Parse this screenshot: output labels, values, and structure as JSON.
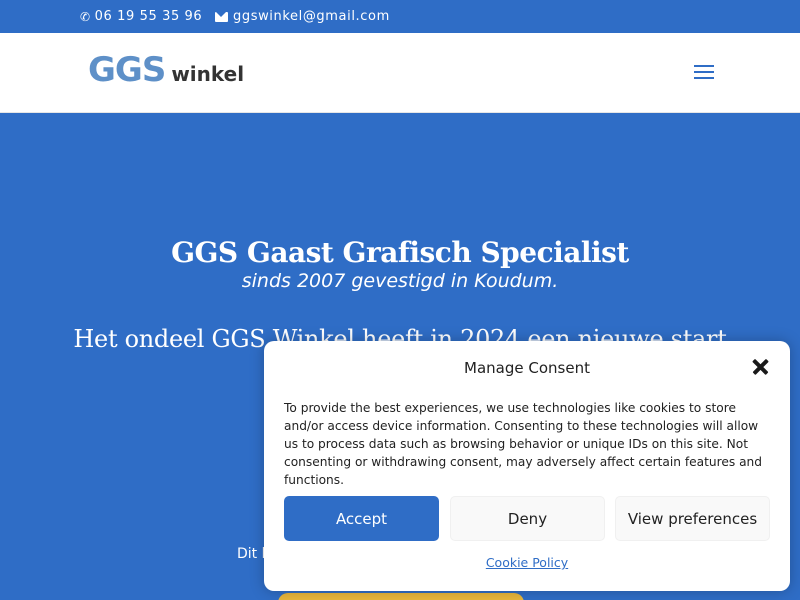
{
  "topbar": {
    "phone": "06 19 55 35 96",
    "email": "ggswinkel@gmail.com",
    "phone_icon": "phone-icon",
    "email_icon": "mail-icon"
  },
  "header": {
    "logo_ggs": "GGS",
    "logo_winkel": "winkel",
    "menu_icon": "hamburger-menu-icon"
  },
  "hero": {
    "title": "GGS Gaast Grafisch Specialist",
    "subtitle": "sinds 2007 gevestigd in Koudum.",
    "line": "Het ondeel GGS Winkel heeft in 2024 een nieuwe start",
    "small_text": "Dit b"
  },
  "consent": {
    "title": "Manage Consent",
    "body": "To provide the best experiences, we use technologies like cookies to store and/or access device information. Consenting to these technologies will allow us to process data such as browsing behavior or unique IDs on this site. Not consenting or withdrawing consent, may adversely affect certain features and functions.",
    "accept_label": "Accept",
    "deny_label": "Deny",
    "preferences_label": "View preferences",
    "policy_label": "Cookie Policy"
  },
  "colors": {
    "brand_blue": "#2f6dc6",
    "logo_blue": "#5e90c8",
    "button_gold": "#e8b73c"
  }
}
